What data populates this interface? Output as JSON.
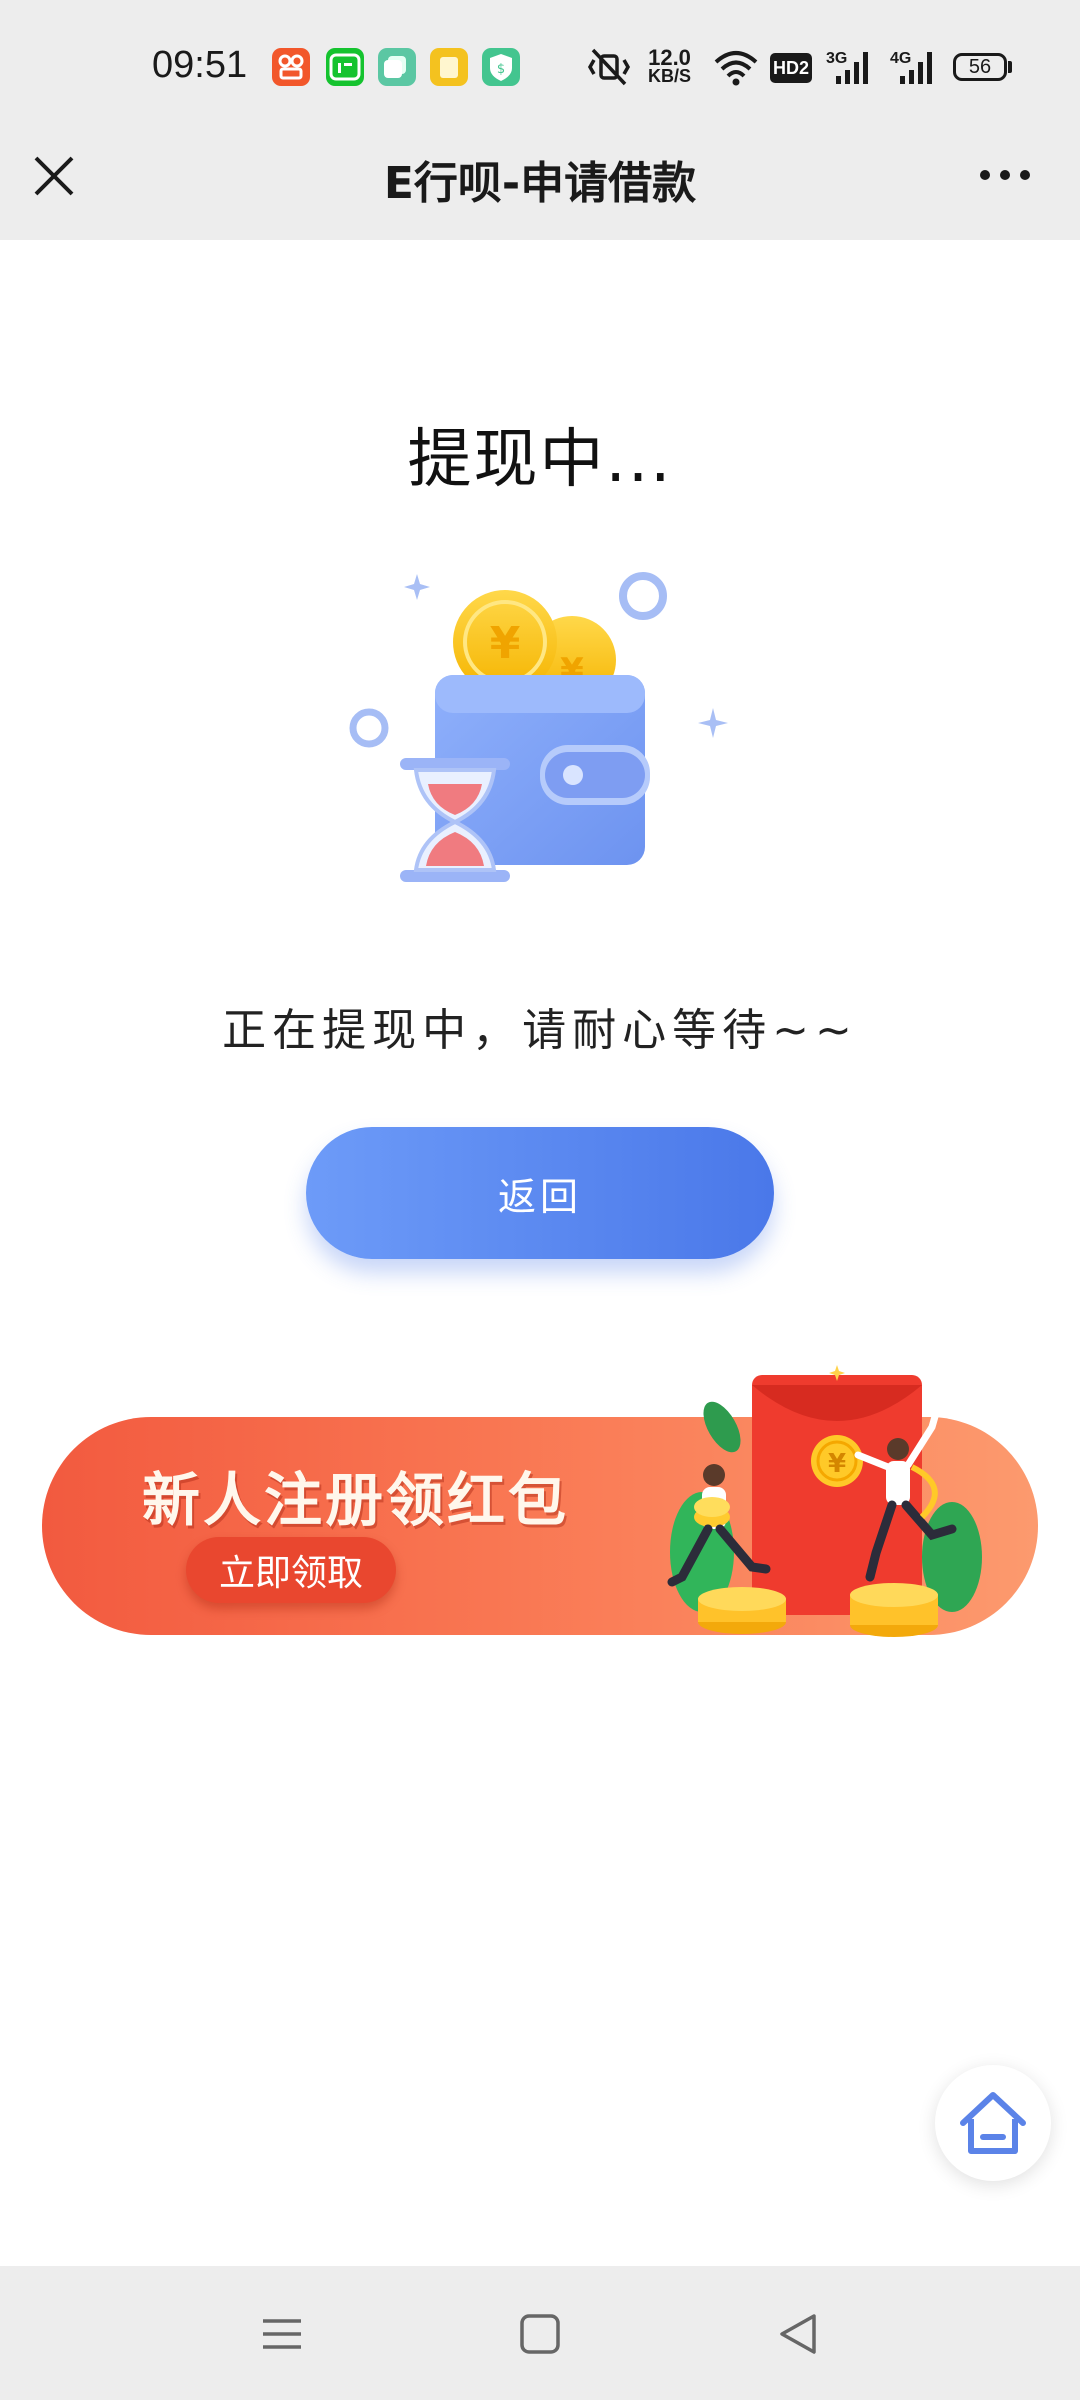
{
  "status_bar": {
    "time": "09:51",
    "net_speed_value": "12.0",
    "net_speed_unit": "KB/S",
    "hd_label": "HD2",
    "network_1": "3G",
    "network_2": "4G",
    "battery": "56",
    "notification_icons": [
      "kuaishou-app-icon",
      "iqiyi-app-icon",
      "multitask-app-icon",
      "notes-app-icon",
      "security-app-icon"
    ]
  },
  "nav": {
    "title": "E行呗-申请借款",
    "close_icon": "close-icon",
    "more_icon": "more-icon"
  },
  "main": {
    "status_title": "提现中...",
    "status_message": "正在提现中，请耐心等待~~",
    "back_label": "返回",
    "illustration_icon": "wallet-hourglass-illustration"
  },
  "promo": {
    "title": "新人注册领红包",
    "cta_label": "立即领取",
    "art_icon": "red-envelope-illustration"
  },
  "floating": {
    "home_icon": "home-icon"
  },
  "system_nav": [
    "menu-icon",
    "home-square-icon",
    "back-triangle-icon"
  ],
  "colors": {
    "accent_blue": "#4a78e9",
    "promo_red": "#f25a3f",
    "bar_gray": "#ededed"
  }
}
